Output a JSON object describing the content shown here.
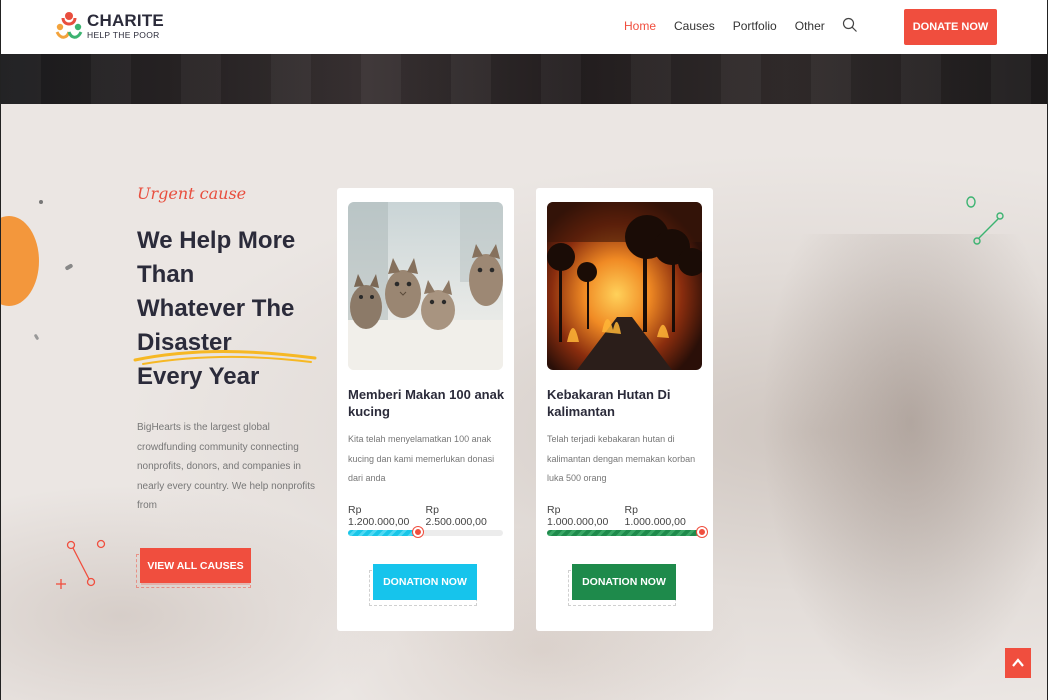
{
  "brand": {
    "title": "CHARITE",
    "subtitle": "HELP THE POOR"
  },
  "nav": {
    "items": [
      {
        "label": "Home",
        "active": true
      },
      {
        "label": "Causes",
        "active": false
      },
      {
        "label": "Portfolio",
        "active": false
      },
      {
        "label": "Other",
        "active": false
      }
    ],
    "search_icon": "search-icon",
    "donate_label": "DONATE NOW"
  },
  "hero": {
    "tagline": "Urgent cause",
    "headline": [
      "We Help More",
      "Than",
      "Whatever The",
      "Disaster",
      "Every Year"
    ],
    "description": "BigHearts is the largest global crowdfunding community connecting nonprofits, donors, and companies in nearly every country. We help nonprofits from",
    "view_all_label": "VIEW ALL CAUSES"
  },
  "causes": [
    {
      "title": "Memberi Makan 100 anak kucing",
      "description": "Kita telah menyelamatkan 100 anak kucing dan kami memerlukan donasi dari anda",
      "raised": "Rp 1.200.000,00",
      "goal": "Rp 2.500.000,00",
      "progress": 0.45,
      "bar_color": "#18c6e8",
      "button_label": "DONATION NOW",
      "button_color": "#16c4ec"
    },
    {
      "title": "Kebakaran Hutan Di kalimantan",
      "description": "Telah terjadi kebakaran hutan di kalimantan dengan memakan korban luka 500 orang",
      "raised": "Rp 1.000.000,00",
      "goal": "Rp 1.000.000,00",
      "progress": 1.0,
      "bar_color": "#1f8a4c",
      "button_label": "DONATION NOW",
      "button_color": "#1e8a4b"
    }
  ],
  "colors": {
    "accent": "#f04e3e",
    "dark_text": "#2b2b3a"
  },
  "scroll_top_icon": "chevron-up-icon"
}
